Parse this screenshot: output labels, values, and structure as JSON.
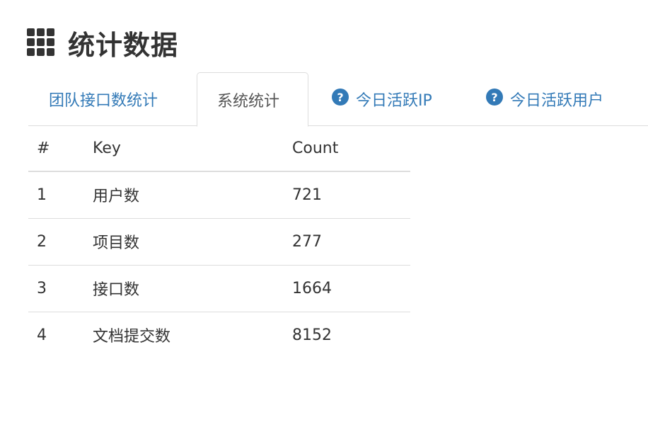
{
  "header": {
    "icon": "th-grid-icon",
    "title": "统计数据"
  },
  "tabs": [
    {
      "label": "团队接口数统计",
      "icon": null,
      "active": false
    },
    {
      "label": "系统统计",
      "icon": null,
      "active": true
    },
    {
      "label": "今日活跃IP",
      "icon": "question-circle-icon",
      "active": false
    },
    {
      "label": "今日活跃用户",
      "icon": "question-circle-icon",
      "active": false
    }
  ],
  "table": {
    "headers": {
      "num": "#",
      "key": "Key",
      "count": "Count"
    },
    "rows": [
      {
        "num": "1",
        "key": "用户数",
        "count": "721"
      },
      {
        "num": "2",
        "key": "项目数",
        "count": "277"
      },
      {
        "num": "3",
        "key": "接口数",
        "count": "1664"
      },
      {
        "num": "4",
        "key": "文档提交数",
        "count": "8152"
      }
    ]
  },
  "colors": {
    "link": "#337ab7",
    "text": "#333333",
    "border": "#dddddd"
  }
}
